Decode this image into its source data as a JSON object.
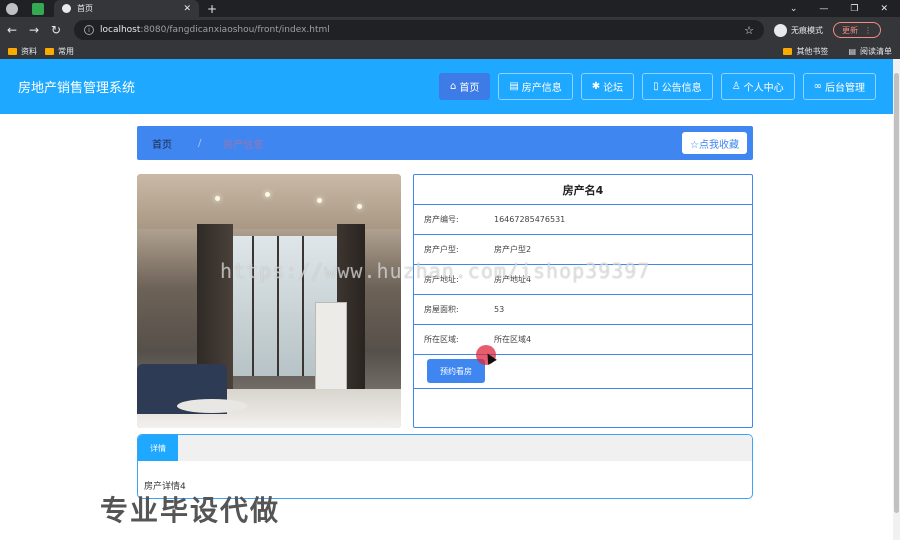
{
  "browser": {
    "tab_title": "首页",
    "url_host": "localhost",
    "url_path": ":8080/fangdicanxiaoshou/front/index.html",
    "incognito_label": "无痕模式",
    "update_label": "更新",
    "bookmarks": [
      "资料",
      "常用"
    ],
    "bookmarks_right": [
      "其他书签",
      "阅读清单"
    ]
  },
  "header": {
    "brand": "房地产销售管理系统",
    "menu": [
      {
        "icon": "⌂",
        "label": "首页"
      },
      {
        "icon": "▤",
        "label": "房产信息"
      },
      {
        "icon": "✱",
        "label": "论坛"
      },
      {
        "icon": "▯",
        "label": "公告信息"
      },
      {
        "icon": "♙",
        "label": "个人中心"
      },
      {
        "icon": "∞",
        "label": "后台管理"
      }
    ]
  },
  "breadcrumb": {
    "home": "首页",
    "separator": "/",
    "current": "房产信息"
  },
  "favorite_button": "☆点我收藏",
  "property": {
    "title": "房产名4",
    "fields": [
      {
        "label": "房产编号:",
        "value": "16467285476531"
      },
      {
        "label": "房产户型:",
        "value": "房产户型2"
      },
      {
        "label": "房产地址:",
        "value": "房产地址4"
      },
      {
        "label": "房屋面积:",
        "value": "53"
      },
      {
        "label": "所在区域:",
        "value": "所在区域4"
      }
    ],
    "book_button": "预约看房"
  },
  "detail": {
    "tab_label": "详情",
    "content": "房产详情4"
  },
  "overlay": {
    "watermark": "https://www.huzhan.com/ishop39397",
    "promo": "专业毕设代做"
  },
  "colors": {
    "header": "#1fa8ff",
    "accent": "#3f86f1"
  }
}
